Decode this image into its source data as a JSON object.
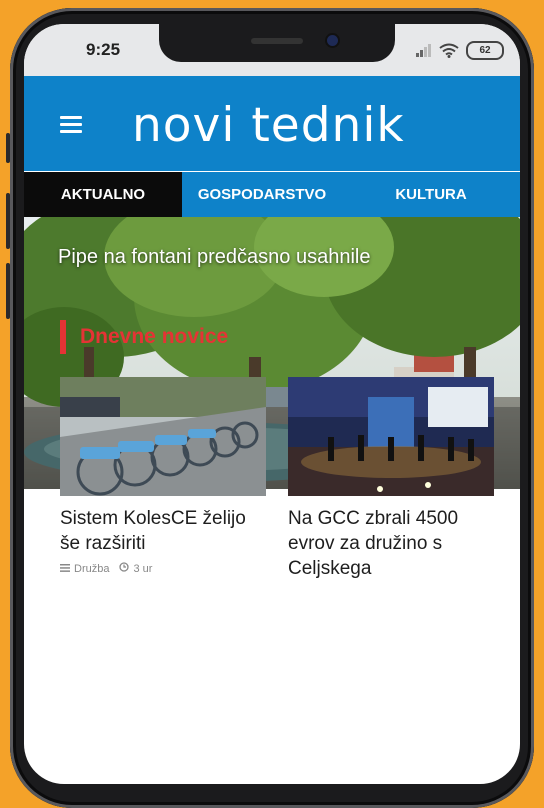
{
  "status_bar": {
    "time": "9:25",
    "battery": "62"
  },
  "header": {
    "logo": "novi tednik"
  },
  "tabs": [
    {
      "label": "AKTUALNO"
    },
    {
      "label": "GOSPODARSTVO"
    },
    {
      "label": "KULTURA"
    }
  ],
  "hero": {
    "caption": "Pipe na fontani predčasno usahnile"
  },
  "section": {
    "title": "Dnevne novice"
  },
  "articles": [
    {
      "title_line1": "Sistem KolesCE želijo",
      "title_line2": "še razširiti",
      "category": "Družba",
      "time": "3 ur"
    },
    {
      "title_line1": "Na GCC zbrali 4500",
      "title_line2": "evrov za družino s",
      "title_line3": "Celjskega"
    }
  ],
  "colors": {
    "brand_blue": "#0e82c9",
    "accent_red": "#e53335",
    "background_orange": "#f4a229"
  }
}
